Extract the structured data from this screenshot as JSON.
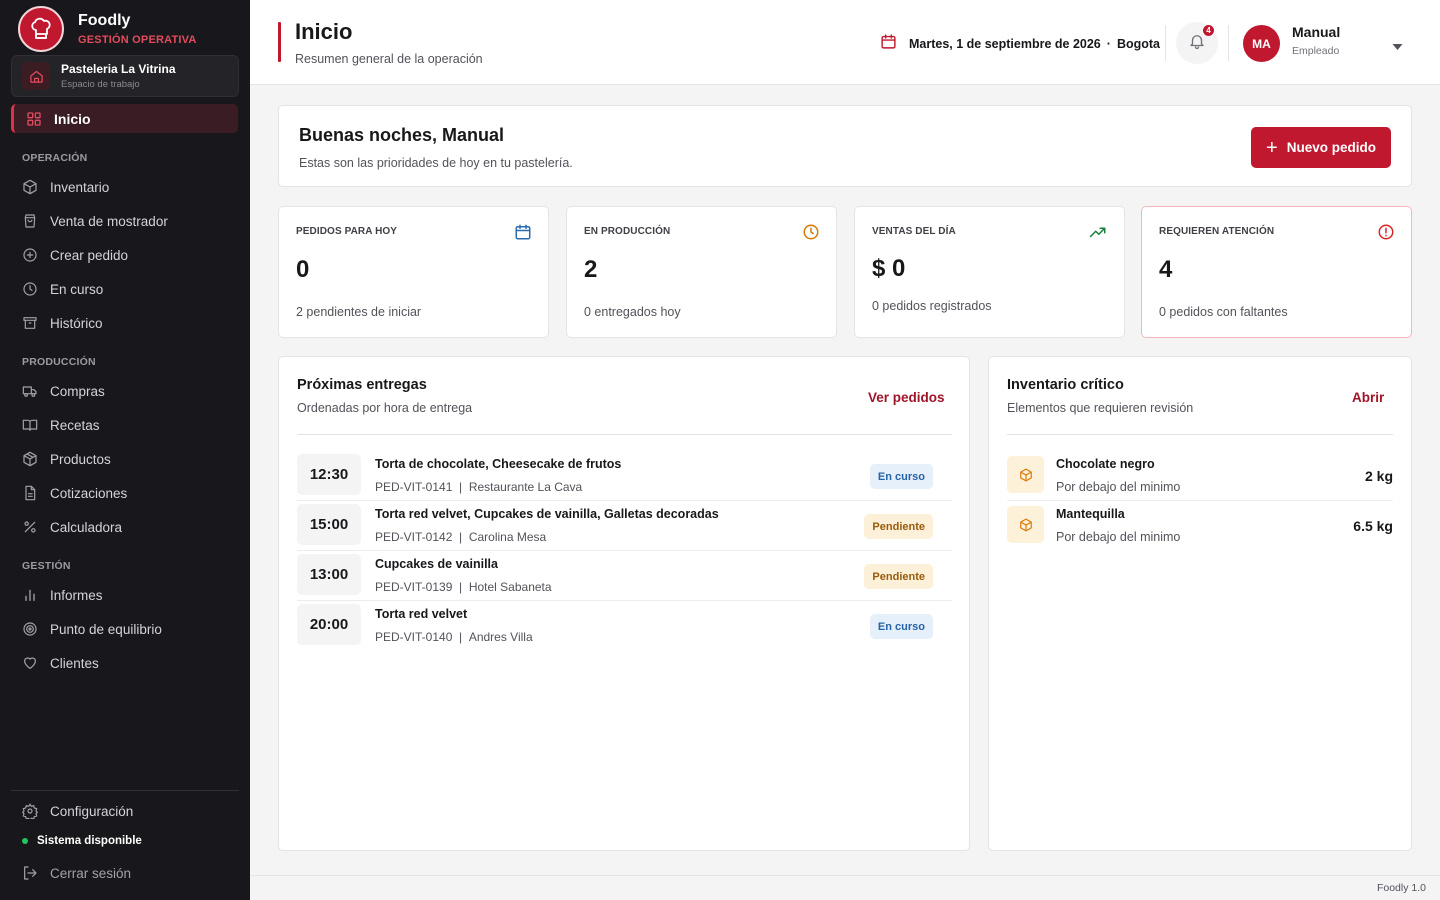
{
  "brand": {
    "name": "Foodly",
    "subtitle": "GESTIÓN OPERATIVA",
    "logo_icon": "chef-hat-icon",
    "accent": "#c0182f"
  },
  "workspace": {
    "name": "Pasteleria La Vitrina",
    "subtitle": "Espacio de trabajo",
    "icon": "home-icon"
  },
  "sidebar": {
    "active": {
      "label": "Inicio",
      "icon": "grid-icon"
    },
    "sections": [
      {
        "title": "OPERACIÓN",
        "items": [
          {
            "label": "Inventario",
            "icon": "box-icon"
          },
          {
            "label": "Venta de mostrador",
            "icon": "shopping-bag-icon"
          },
          {
            "label": "Crear pedido",
            "icon": "plus-circle-icon"
          },
          {
            "label": "En curso",
            "icon": "clock-icon"
          },
          {
            "label": "Histórico",
            "icon": "archive-icon"
          }
        ]
      },
      {
        "title": "PRODUCCIÓN",
        "items": [
          {
            "label": "Compras",
            "icon": "truck-icon"
          },
          {
            "label": "Recetas",
            "icon": "book-icon"
          },
          {
            "label": "Productos",
            "icon": "package-icon"
          },
          {
            "label": "Cotizaciones",
            "icon": "document-icon"
          },
          {
            "label": "Calculadora",
            "icon": "percent-icon"
          }
        ]
      },
      {
        "title": "GESTIÓN",
        "items": [
          {
            "label": "Informes",
            "icon": "bar-chart-icon"
          },
          {
            "label": "Punto de equilibrio",
            "icon": "target-icon"
          },
          {
            "label": "Clientes",
            "icon": "heart-icon"
          }
        ]
      }
    ],
    "settings_label": "Configuración",
    "status_label": "Sistema disponible",
    "logout_label": "Cerrar sesión"
  },
  "header": {
    "title": "Inicio",
    "subtitle": "Resumen general de la operación",
    "date": "Martes, 1 de septiembre de 2026",
    "city": "Bogota",
    "notifications_count": "4",
    "user": {
      "initials": "MA",
      "name": "Manual",
      "role": "Empleado"
    }
  },
  "welcome": {
    "title": "Buenas noches, Manual",
    "subtitle": "Estas son las prioridades de hoy en tu pastelería.",
    "button_label": "Nuevo pedido"
  },
  "stats": [
    {
      "label": "PEDIDOS PARA HOY",
      "value": "0",
      "note": "2 pendientes de iniciar",
      "icon": "calendar-icon",
      "color": "#2b6cb0"
    },
    {
      "label": "EN PRODUCCIÓN",
      "value": "2",
      "note": "0 entregados hoy",
      "icon": "clock-icon",
      "color": "#d97706"
    },
    {
      "label": "VENTAS DEL DÍA",
      "value": "$ 0",
      "note": "0 pedidos registrados",
      "icon": "trending-up-icon",
      "color": "#15803d"
    },
    {
      "label": "REQUIEREN ATENCIÓN",
      "value": "4",
      "note": "0 pedidos con faltantes",
      "icon": "alert-circle-icon",
      "color": "#dc2626"
    }
  ],
  "deliveries": {
    "title": "Próximas entregas",
    "subtitle": "Ordenadas por hora de entrega",
    "link": "Ver pedidos",
    "rows": [
      {
        "time": "12:30",
        "title": "Torta de chocolate, Cheesecake de frutos",
        "code": "PED-VIT-0141",
        "client": "Restaurante La Cava",
        "status": "En curso"
      },
      {
        "time": "15:00",
        "title": "Torta red velvet, Cupcakes de vainilla, Galletas decoradas",
        "code": "PED-VIT-0142",
        "client": "Carolina Mesa",
        "status": "Pendiente"
      },
      {
        "time": "13:00",
        "title": "Cupcakes de vainilla",
        "code": "PED-VIT-0139",
        "client": "Hotel Sabaneta",
        "status": "Pendiente"
      },
      {
        "time": "20:00",
        "title": "Torta red velvet",
        "code": "PED-VIT-0140",
        "client": "Andres Villa",
        "status": "En curso"
      }
    ]
  },
  "inventory": {
    "title": "Inventario crítico",
    "subtitle": "Elementos que requieren revisión",
    "link": "Abrir",
    "rows": [
      {
        "name": "Chocolate negro",
        "note": "Por debajo del minimo",
        "qty": "2 kg"
      },
      {
        "name": "Mantequilla",
        "note": "Por debajo del minimo",
        "qty": "6.5 kg"
      }
    ]
  },
  "footer": {
    "version": "Foodly 1.0"
  }
}
